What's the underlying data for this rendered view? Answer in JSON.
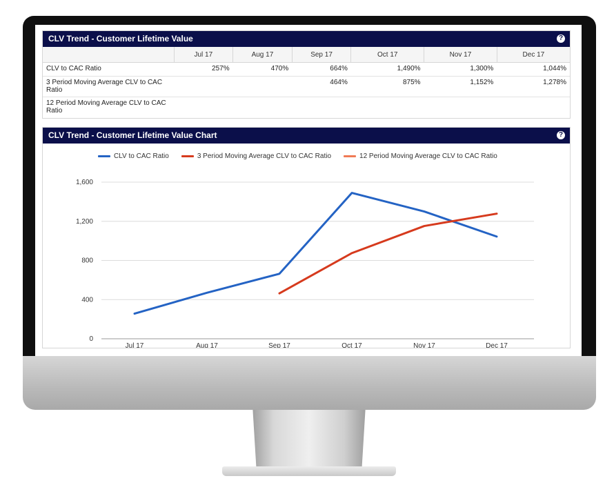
{
  "table_panel": {
    "title": "CLV Trend - Customer Lifetime Value",
    "help_icon": "?",
    "columns": [
      "Jul 17",
      "Aug 17",
      "Sep 17",
      "Oct 17",
      "Nov 17",
      "Dec 17"
    ],
    "rows": [
      {
        "label": "CLV to CAC Ratio",
        "values": [
          "257%",
          "470%",
          "664%",
          "1,490%",
          "1,300%",
          "1,044%"
        ]
      },
      {
        "label": "3 Period Moving Average CLV to CAC Ratio",
        "values": [
          "",
          "",
          "464%",
          "875%",
          "1,152%",
          "1,278%"
        ]
      },
      {
        "label": "12 Period Moving Average CLV to CAC Ratio",
        "values": [
          "",
          "",
          "",
          "",
          "",
          ""
        ]
      }
    ]
  },
  "chart_panel": {
    "title": "CLV Trend - Customer Lifetime Value Chart",
    "help_icon": "?"
  },
  "chart_data": {
    "type": "line",
    "title": "",
    "xlabel": "",
    "ylabel": "",
    "categories": [
      "Jul 17",
      "Aug 17",
      "Sep 17",
      "Oct 17",
      "Nov 17",
      "Dec 17"
    ],
    "ylim": [
      0,
      1600
    ],
    "yticks": [
      0,
      400,
      800,
      1200,
      1600
    ],
    "ytick_labels": [
      "0",
      "400",
      "800",
      "1,200",
      "1,600"
    ],
    "grid": true,
    "legend_position": "top",
    "series": [
      {
        "name": "CLV to CAC Ratio",
        "color": "#2463c4",
        "values": [
          257,
          470,
          664,
          1490,
          1300,
          1044
        ]
      },
      {
        "name": "3 Period Moving Average CLV to CAC Ratio",
        "color": "#d63a1d",
        "values": [
          null,
          null,
          464,
          875,
          1152,
          1278
        ]
      },
      {
        "name": "12 Period Moving Average CLV to CAC Ratio",
        "color": "#f07a55",
        "values": [
          null,
          null,
          null,
          null,
          null,
          null
        ]
      }
    ]
  }
}
